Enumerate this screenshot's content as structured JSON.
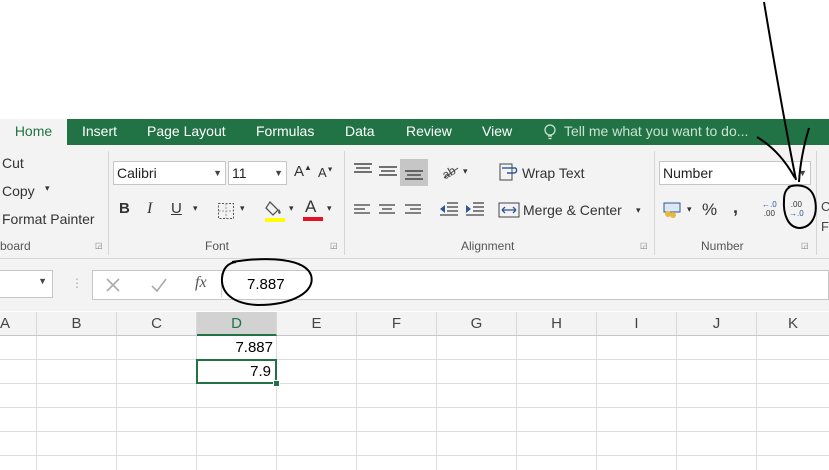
{
  "tabs": {
    "home": "Home",
    "insert": "Insert",
    "page_layout": "Page Layout",
    "formulas": "Formulas",
    "data": "Data",
    "review": "Review",
    "view": "View",
    "tell_me": "Tell me what you want to do..."
  },
  "clipboard": {
    "cut": "Cut",
    "copy": "Copy",
    "format_painter": "Format Painter",
    "label": "board"
  },
  "font": {
    "family": "Calibri",
    "size": "11",
    "bold": "B",
    "italic": "I",
    "underline": "U",
    "font_color_glyph": "A",
    "label": "Font"
  },
  "alignment": {
    "wrap_text": "Wrap Text",
    "merge_center": "Merge & Center",
    "label": "Alignment"
  },
  "number": {
    "format": "Number",
    "percent": "%",
    "comma": ",",
    "label": "Number"
  },
  "formula_bar": {
    "fx": "fx",
    "value": "7.887"
  },
  "columns": [
    "A",
    "B",
    "C",
    "D",
    "E",
    "F",
    "G",
    "H",
    "I",
    "J",
    "K"
  ],
  "cells": {
    "d1": "7.887",
    "d2": "7.9"
  },
  "colors": {
    "accent": "#217346",
    "ribbon": "#f3f3f3"
  }
}
